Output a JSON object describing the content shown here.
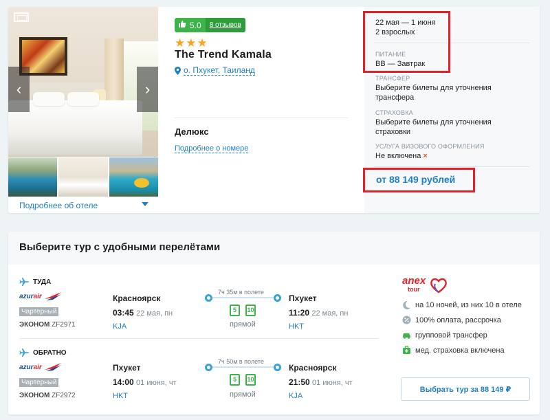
{
  "hotel": {
    "rating": "5.0",
    "reviews": "8 отзывов",
    "stars": "★★★",
    "name": "The Trend Kamala",
    "location": "о. Пхукет, Таиланд",
    "room_name": "Делюкс",
    "room_link": "Подробнее о номере",
    "about_link": "Подробнее об отеле",
    "nav_prev": "‹",
    "nav_next": "›"
  },
  "summary": {
    "dates": "22 мая — 1 июня",
    "guests": "2 взрослых",
    "meal_label": "ПИТАНИЕ",
    "meal_value": "BB — Завтрак",
    "transfer_label": "ТРАНСФЕР",
    "transfer_value": "Выберите билеты для уточнения трансфера",
    "insurance_label": "СТРАХОВКА",
    "insurance_value": "Выберите билеты для уточнения страховки",
    "visa_label": "УСЛУГА ВИЗОВОГО ОФОРМЛЕНИЯ",
    "visa_value": "Не включена",
    "visa_mark": "×",
    "price": "от 88 149 рублей"
  },
  "flights": {
    "title": "Выберите тур с удобными перелётами",
    "outbound": {
      "direction": "ТУДА",
      "airline_a": "azur",
      "airline_b": "air",
      "charter": "Чартерный",
      "class": "ЭКОНОМ",
      "flight_no": "ZF2971",
      "from_city": "Красноярск",
      "from_time": "03:45",
      "from_date": "22 мая, пн",
      "from_code": "KJA",
      "duration": "7ч 35м в полете",
      "bag_hand": "5",
      "bag_checked": "10",
      "direct": "прямой",
      "to_city": "Пхукет",
      "to_time": "11:20",
      "to_date": "22 мая, пн",
      "to_code": "HKT"
    },
    "inbound": {
      "direction": "ОБРАТНО",
      "airline_a": "azur",
      "airline_b": "air",
      "charter": "Чартерный",
      "class": "ЭКОНОМ",
      "flight_no": "ZF2972",
      "from_city": "Пхукет",
      "from_time": "14:00",
      "from_date": "01 июня, чт",
      "from_code": "HKT",
      "duration": "7ч 50м в полете",
      "bag_hand": "5",
      "bag_checked": "10",
      "direct": "прямой",
      "to_city": "Красноярск",
      "to_time": "21:50",
      "to_date": "01 июня, чт",
      "to_code": "KJA"
    },
    "operator": {
      "brand": "anex",
      "brand_sub": "tour",
      "features": [
        "на 10 ночей, из них 10 в отеле",
        "100% оплата, рассрочка",
        "групповой трансфер",
        "мед. страховка включена"
      ]
    },
    "book_button": "Выбрать тур за 88 149 ₽"
  },
  "colors": {
    "accent": "#1f7fc4",
    "rating_green": "#3db34a",
    "highlight": "#e0232b",
    "star": "#f5a623"
  }
}
